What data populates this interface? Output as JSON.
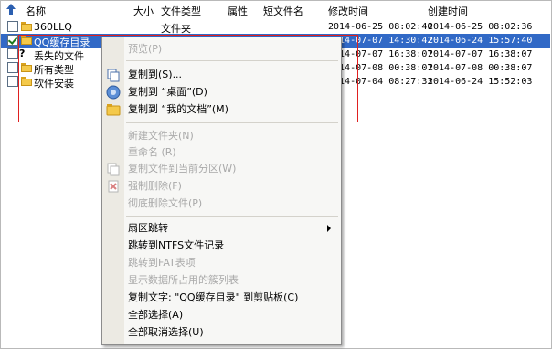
{
  "header": {
    "name": "名称",
    "size": "大小",
    "type": "文件类型",
    "attr": "属性",
    "short_name": "短文件名",
    "modified": "修改时间",
    "created": "创建时间"
  },
  "rows": [
    {
      "name": "360LLQ",
      "type": "文件夹",
      "short": "",
      "modified": "2014-06-25 08:02:40",
      "created": "2014-06-25 08:02:36"
    },
    {
      "name": "QQ缓存目录",
      "type": "",
      "short": "",
      "modified": "2014-07-07 14:30:42",
      "created": "2014-06-24 15:57:40"
    },
    {
      "name": "丢失的文件",
      "type": "",
      "short": "",
      "modified": "2014-07-07 16:38:07",
      "created": "2014-07-07 16:38:07"
    },
    {
      "name": "所有类型",
      "type": "",
      "short": "",
      "modified": "2014-07-08 00:38:07",
      "created": "2014-07-08 00:38:07"
    },
    {
      "name": "软件安装",
      "type": "",
      "short": "",
      "modified": "2014-07-04 08:27:33",
      "created": "2014-06-24 15:52:03"
    }
  ],
  "menu": {
    "preview": "预览(P)",
    "copy_to": "复制到(S)...",
    "copy_desktop": "复制到 “桌面”(D)",
    "copy_mydocs": "复制到 “我的文档”(M)",
    "new_folder": "新建文件夹(N)",
    "rename": "重命名 (R)",
    "copy_partition": "复制文件到当前分区(W)",
    "force_delete": "强制删除(F)",
    "wipe_delete": "彻底删除文件(P)",
    "sector_jump": "扇区跳转",
    "ntfs_jump": "跳转到NTFS文件记录",
    "fat_jump": "跳转到FAT表项",
    "cluster_list": "显示数据所占用的簇列表",
    "copy_text": "复制文字: \"QQ缓存目录\" 到剪贴板(C)",
    "select_all": "全部选择(A)",
    "deselect_all": "全部取消选择(U)"
  },
  "colors": {
    "selection": "#3169c6",
    "highlight_box": "#e02020"
  }
}
